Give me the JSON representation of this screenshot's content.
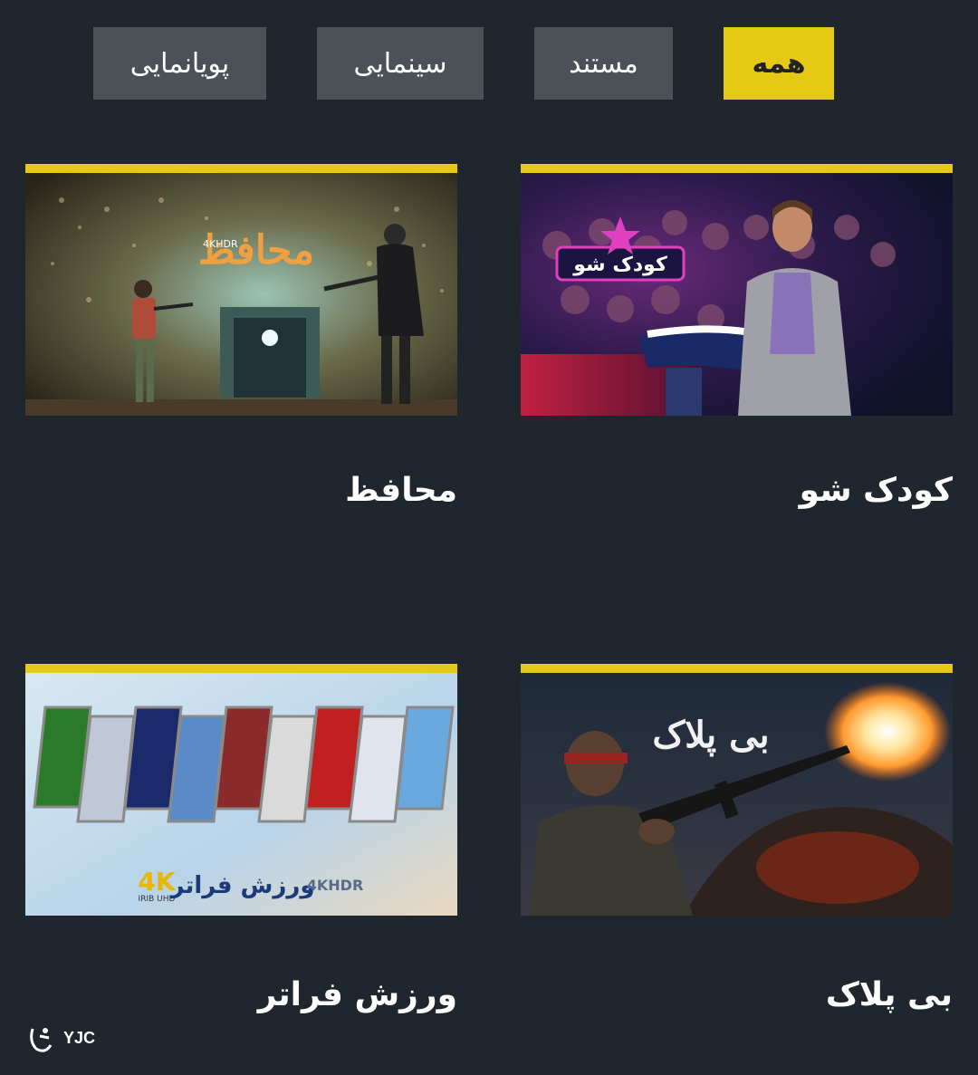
{
  "tabs": [
    {
      "label": "همه",
      "active": true
    },
    {
      "label": "مستند",
      "active": false
    },
    {
      "label": "سینمایی",
      "active": false
    },
    {
      "label": "پویانمایی",
      "active": false
    }
  ],
  "cards": [
    {
      "title": "کودک شو",
      "thumb_logo": "کودک شو",
      "thumb_icon": "game-show-host-image"
    },
    {
      "title": "محافظ",
      "thumb_logo": "محافظ",
      "thumb_badge": "4KHDR",
      "thumb_icon": "shrine-standoff-image"
    },
    {
      "title": "بی پلاک",
      "thumb_logo": "بی پلاک",
      "thumb_icon": "soldier-firing-image"
    },
    {
      "title": "ورزش فراتر",
      "thumb_logo": "ورزش فراتر",
      "thumb_badge_left": "4K",
      "thumb_badge_left_sub": "IRIB UHD",
      "thumb_badge": "4KHDR",
      "thumb_icon": "sports-collage-image"
    }
  ],
  "watermark": {
    "text": "YJC"
  },
  "colors": {
    "background": "#20262d",
    "accent": "#e6c914",
    "tab_inactive": "#4c5158"
  }
}
